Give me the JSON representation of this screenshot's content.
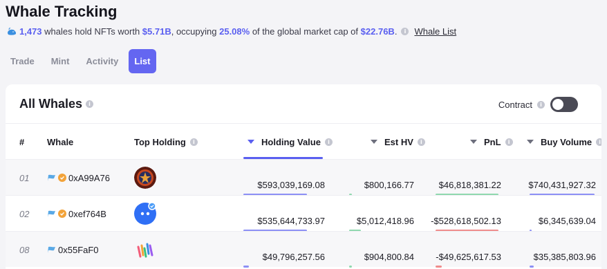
{
  "title": "Whale Tracking",
  "summary": {
    "whale_count": "1,473",
    "text_1": "whales hold NFTs worth",
    "worth": "$5.71B",
    "text_2": ", occupying",
    "pct": "25.08%",
    "text_3": "of the global market cap of",
    "market_cap": "$22.76B",
    "text_4": ".",
    "link": "Whale List"
  },
  "tabs": [
    "Trade",
    "Mint",
    "Activity",
    "List"
  ],
  "active_tab": "List",
  "card": {
    "title": "All Whales",
    "contract_label": "Contract",
    "contract_toggle_on": false
  },
  "columns": {
    "rank": "#",
    "whale": "Whale",
    "top_holding": "Top Holding",
    "holding_value": "Holding Value",
    "est_hv": "Est HV",
    "pnl": "PnL",
    "buy_volume": "Buy Volume"
  },
  "rows": [
    {
      "rank": "01",
      "whale": "0xA99A76",
      "verified": true,
      "holding_icon": "star-medallion-icon",
      "holding_value": "$593,039,169.08",
      "est_hv": "$800,166.77",
      "pnl": "$46,818,381.22",
      "buy_volume": "$740,431,927.32",
      "hv_fill": 0.78,
      "est_fill": 0.04,
      "pnl_fill": 0.96,
      "buy_fill": 0.98,
      "pnl_positive": true
    },
    {
      "rank": "02",
      "whale": "0xef764B",
      "verified": true,
      "holding_icon": "blue-robot-icon",
      "holding_value": "$535,644,733.97",
      "est_hv": "$5,012,418.96",
      "pnl": "-$528,618,502.13",
      "buy_volume": "$6,345,639.04",
      "hv_fill": 0.78,
      "est_fill": 0.18,
      "pnl_fill": 0.96,
      "buy_fill": 0.03,
      "pnl_positive": false
    },
    {
      "rank": "08",
      "whale": "0x55FaF0",
      "verified": false,
      "holding_icon": "rainbow-wave-icon",
      "holding_value": "$49,796,257.56",
      "est_hv": "$904,800.84",
      "pnl": "-$49,625,617.53",
      "buy_volume": "$35,385,803.96",
      "hv_fill": 0.07,
      "est_fill": 0.04,
      "pnl_fill": 0.09,
      "buy_fill": 0.06,
      "pnl_positive": false
    }
  ],
  "colors": {
    "accent": "#6466f1",
    "bar_hv": "#8c8ff5",
    "bar_est": "#8fd8ae",
    "bar_pnl_pos": "#8fd8ae",
    "bar_pnl_neg": "#ef8c8c",
    "bar_buy": "#8c8ff5",
    "bar_track": "#eceef4"
  }
}
